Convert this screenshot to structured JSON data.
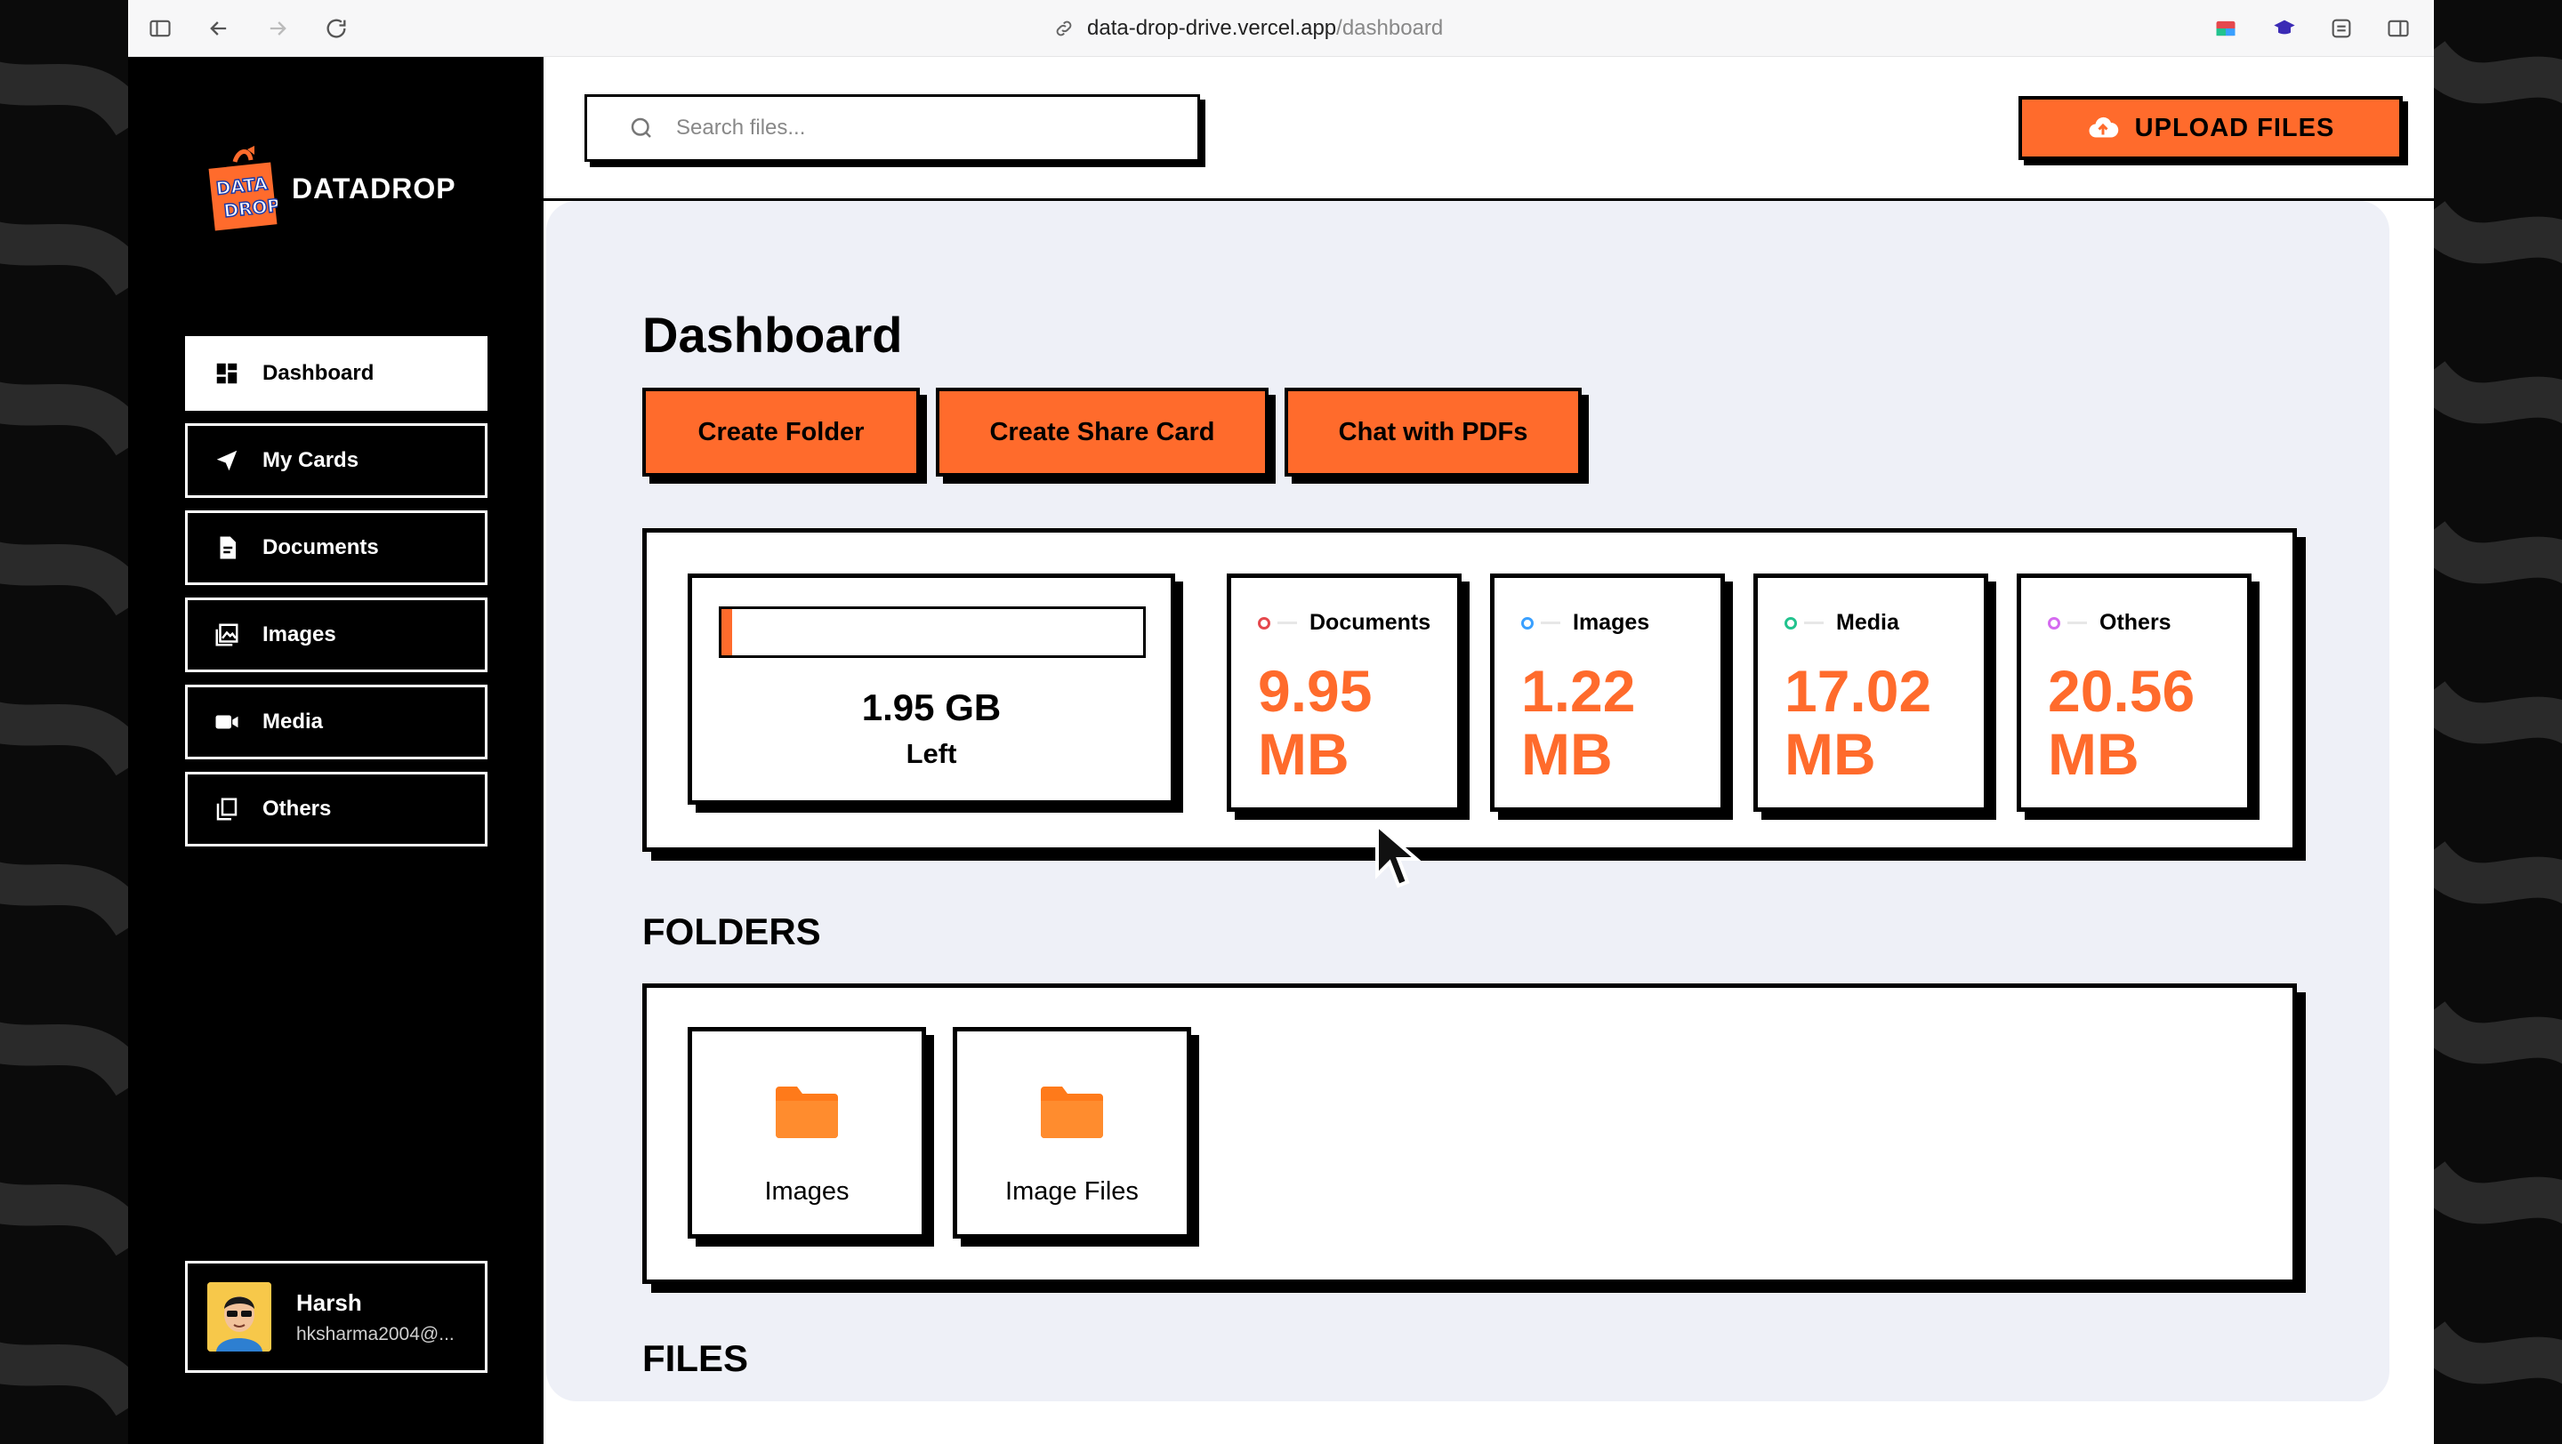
{
  "browser": {
    "url_host": "data-drop-drive.vercel.app",
    "url_path": "/dashboard"
  },
  "sidebar": {
    "brand": "DATADROP",
    "items": [
      {
        "label": "Dashboard",
        "icon": "dashboard-icon",
        "active": true
      },
      {
        "label": "My Cards",
        "icon": "send-icon",
        "active": false
      },
      {
        "label": "Documents",
        "icon": "document-icon",
        "active": false
      },
      {
        "label": "Images",
        "icon": "image-icon",
        "active": false
      },
      {
        "label": "Media",
        "icon": "video-icon",
        "active": false
      },
      {
        "label": "Others",
        "icon": "copy-icon",
        "active": false
      }
    ],
    "profile": {
      "name": "Harsh",
      "email": "hksharma2004@..."
    }
  },
  "topbar": {
    "search_placeholder": "Search files...",
    "upload_label": "UPLOAD FILES"
  },
  "main": {
    "title": "Dashboard",
    "actions": [
      "Create Folder",
      "Create Share Card",
      "Chat with PDFs"
    ],
    "storage": {
      "used_fraction": 0.025,
      "space_value": "1.95 GB",
      "space_label": "Left",
      "categories": [
        {
          "name": "Documents",
          "size_num": "9.95",
          "size_unit": "MB",
          "color": "#e5484d"
        },
        {
          "name": "Images",
          "size_num": "1.22",
          "size_unit": "MB",
          "color": "#3aa0ff"
        },
        {
          "name": "Media",
          "size_num": "17.02",
          "size_unit": "MB",
          "color": "#22c38e"
        },
        {
          "name": "Others",
          "size_num": "20.56",
          "size_unit": "MB",
          "color": "#d56bf0"
        }
      ]
    },
    "folders_title": "FOLDERS",
    "folders": [
      {
        "name": "Images"
      },
      {
        "name": "Image Files"
      }
    ],
    "files_title": "FILES"
  },
  "colors": {
    "accent": "#ff6b2c",
    "sidebar_bg": "#000000",
    "main_bg": "#eef0f7"
  }
}
